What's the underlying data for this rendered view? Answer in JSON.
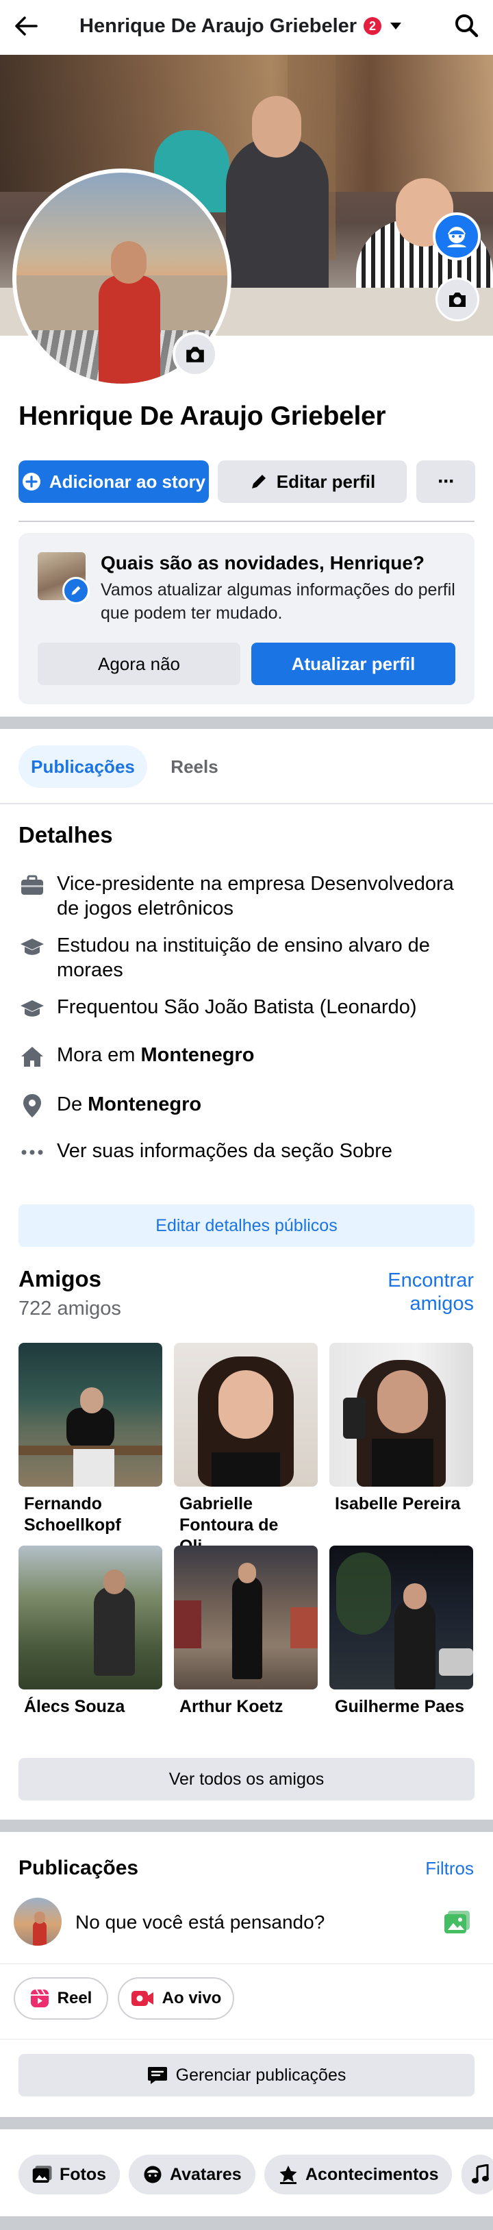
{
  "header": {
    "title": "Henrique De Araujo Griebeler",
    "notification_count": "2"
  },
  "profile": {
    "name": "Henrique De Araujo Griebeler",
    "add_story_label": "Adicionar ao story",
    "edit_profile_label": "Editar perfil",
    "more_label": "···"
  },
  "update_card": {
    "heading": "Quais são as novidades, Henrique?",
    "description": "Vamos atualizar algumas informações do perfil que podem ter mudado.",
    "later_label": "Agora não",
    "update_label": "Atualizar perfil"
  },
  "tabs": [
    {
      "label": "Publicações",
      "active": true
    },
    {
      "label": "Reels",
      "active": false
    }
  ],
  "details": {
    "title": "Detalhes",
    "work": "Vice-presidente na empresa Desenvolvedora de jogos eletrônicos",
    "education": "Estudou na instituição de ensino alvaro de moraes",
    "school": "Frequentou São João Batista (Leonardo)",
    "lives_prefix": "Mora em ",
    "lives_city": "Montenegro",
    "from_prefix": "De ",
    "from_city": "Montenegro",
    "about_link": "Ver suas informações da seção Sobre",
    "edit_public_label": "Editar detalhes públicos"
  },
  "friends": {
    "title": "Amigos",
    "count": "722 amigos",
    "find_label": "Encontrar amigos",
    "list": [
      {
        "name": "Fernando Schoellkopf"
      },
      {
        "name": "Gabrielle Fontoura de Oli…"
      },
      {
        "name": "Isabelle Pereira"
      },
      {
        "name": "Álecs Souza"
      },
      {
        "name": "Arthur Koetz"
      },
      {
        "name": "Guilherme Paes"
      }
    ],
    "see_all_label": "Ver todos os amigos"
  },
  "posts": {
    "title": "Publicações",
    "filters_label": "Filtros",
    "composer_placeholder": "No que você está pensando?",
    "reel_label": "Reel",
    "live_label": "Ao vivo",
    "manage_label": "Gerenciar publicações"
  },
  "bottom_chips": [
    {
      "label": "Fotos"
    },
    {
      "label": "Avatares"
    },
    {
      "label": "Acontecimentos"
    }
  ],
  "colors": {
    "accent": "#1b74e4",
    "badge": "#e41e3f",
    "separator": "#c9ccd1"
  }
}
